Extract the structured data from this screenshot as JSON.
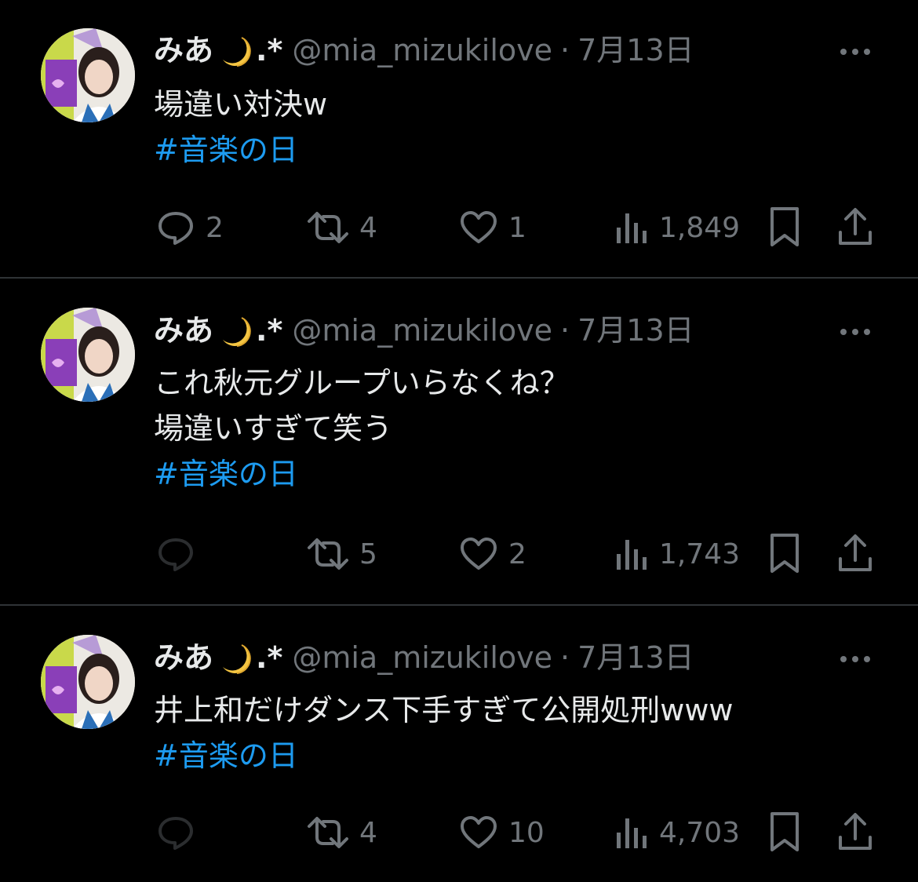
{
  "accent_color": "#1d9bf0",
  "muted_color": "#71767b",
  "text_color": "#e7e9ea",
  "more_icon": "more-horizontal-icon",
  "tweets": [
    {
      "display_name": "みあ",
      "name_suffix": ".*",
      "name_emoji": "crescent-moon-icon",
      "handle": "@mia_mizukilove",
      "separator": "·",
      "date": "7月13日",
      "text_lines": [
        "場違い対決w"
      ],
      "hashtag": "#音楽の日",
      "actions": {
        "reply_count": "2",
        "retweet_count": "4",
        "like_count": "1",
        "view_count": "1,849"
      }
    },
    {
      "display_name": "みあ",
      "name_suffix": ".*",
      "name_emoji": "crescent-moon-icon",
      "handle": "@mia_mizukilove",
      "separator": "·",
      "date": "7月13日",
      "text_lines": [
        "これ秋元グループいらなくね？",
        "場違いすぎて笑う"
      ],
      "hashtag": "#音楽の日",
      "actions": {
        "reply_count": "",
        "retweet_count": "5",
        "like_count": "2",
        "view_count": "1,743"
      }
    },
    {
      "display_name": "みあ",
      "name_suffix": ".*",
      "name_emoji": "crescent-moon-icon",
      "handle": "@mia_mizukilove",
      "separator": "·",
      "date": "7月13日",
      "text_lines": [
        "井上和だけダンス下手すぎて公開処刑www"
      ],
      "hashtag": "#音楽の日",
      "actions": {
        "reply_count": "",
        "retweet_count": "4",
        "like_count": "10",
        "view_count": "4,703"
      }
    }
  ]
}
